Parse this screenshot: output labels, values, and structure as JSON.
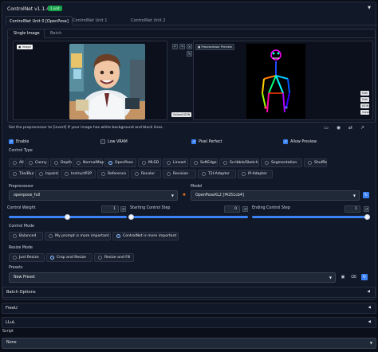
{
  "header": {
    "title": "ControlNet v1.1.426",
    "badge": "1 unit"
  },
  "top_tabs": [
    "ControlNet Unit 0 [OpenPose]",
    "ControlNet Unit 1",
    "ControlNet Unit 2"
  ],
  "sub_tabs": [
    "Single Image",
    "Batch"
  ],
  "image_panel": {
    "tag": "Image",
    "upload_json": "Upload JSON"
  },
  "preview_panel": {
    "tag": "Preprocessor Preview",
    "buttons": [
      "Edit",
      "Edit",
      "JSON",
      "Close"
    ]
  },
  "hint": "Set the preprocessor to [invert] If your image has white background and black lines.",
  "options": {
    "enable": "Enable",
    "low_vram": "Low VRAM",
    "pixel_perfect": "Pixel Perfect",
    "allow_preview": "Allow Preview"
  },
  "control_type": {
    "label": "Control Type",
    "row1": [
      "All",
      "Canny",
      "Depth",
      "NormalMap",
      "OpenPose",
      "MLSD",
      "Lineart",
      "SoftEdge",
      "Scribble/Sketch",
      "Segmentation",
      "Shuffle"
    ],
    "row2": [
      "Tile/Blur",
      "Inpaint",
      "InstructP2P",
      "Reference",
      "Recolor",
      "Revision",
      "T2I-Adapter",
      "IP-Adapter"
    ],
    "selected": "OpenPose"
  },
  "preprocessor": {
    "label": "Preprocessor",
    "value": "openpose_full"
  },
  "model": {
    "label": "Model",
    "value": "OpenPoseXL2 [f4251cb4]"
  },
  "control_weight": {
    "label": "Control Weight",
    "value": "1"
  },
  "starting_step": {
    "label": "Starting Control Step",
    "value": "0"
  },
  "ending_step": {
    "label": "Ending Control Step",
    "value": "1"
  },
  "control_mode": {
    "label": "Control Mode",
    "options": [
      "Balanced",
      "My prompt is more important",
      "ControlNet is more important"
    ],
    "selected": "ControlNet is more important"
  },
  "resize_mode": {
    "label": "Resize Mode",
    "options": [
      "Just Resize",
      "Crop and Resize",
      "Resize and Fill"
    ],
    "selected": "Crop and Resize"
  },
  "presets": {
    "label": "Presets",
    "value": "New Preset"
  },
  "bottom_sections": [
    "Batch Options",
    "FreeU",
    "LLuL"
  ],
  "script": {
    "label": "Script",
    "value": "None"
  },
  "colors": {
    "accent": "#3b82f6",
    "badge": "#16a34a",
    "background": "#0b0f19"
  }
}
